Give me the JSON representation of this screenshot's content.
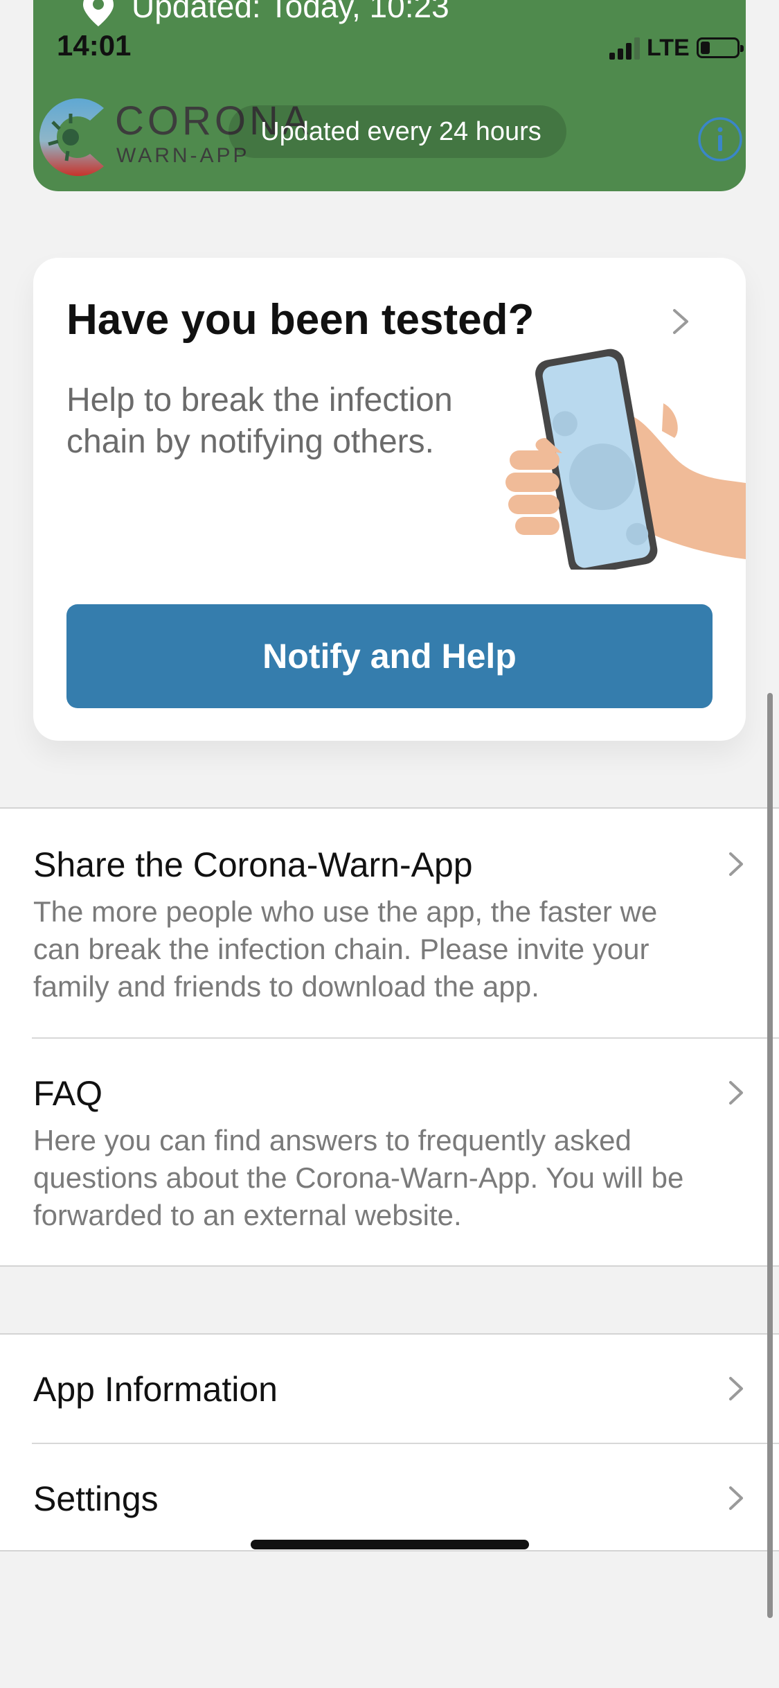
{
  "status_bar": {
    "time": "14:01",
    "network": "LTE",
    "battery_level": 0.25
  },
  "risk_card": {
    "updated_text": "Updated: Today, 10:23",
    "update_interval": "Updated every 24 hours",
    "color": "#4f8a4d"
  },
  "logo": {
    "title": "CORONA",
    "subtitle": "WARN-APP"
  },
  "test_card": {
    "title": "Have you been tested?",
    "description": "Help to break the infection chain by notifying others.",
    "button_label": "Notify and Help",
    "button_color": "#357dad"
  },
  "info_list": [
    {
      "title": "Share the Corona-Warn-App",
      "description": "The more people who use the app, the faster we can break the infection chain. Please invite your family and friends to download the app."
    },
    {
      "title": "FAQ",
      "description": "Here you can find answers to frequently asked questions about the Corona-Warn-App. You will be forwarded to an external website."
    }
  ],
  "settings_list": [
    {
      "title": "App Information"
    },
    {
      "title": "Settings"
    }
  ]
}
